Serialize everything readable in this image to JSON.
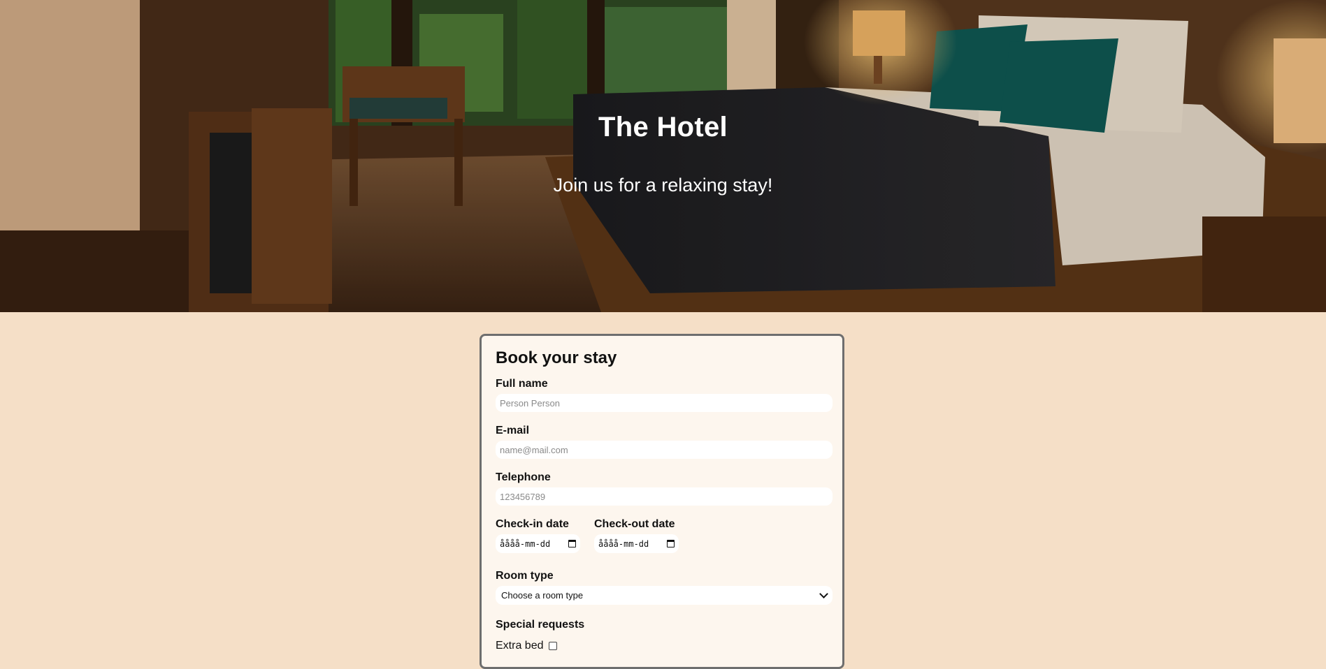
{
  "hero": {
    "title": "The Hotel",
    "subtitle": "Join us for a relaxing stay!"
  },
  "form": {
    "title": "Book your stay",
    "full_name": {
      "label": "Full name",
      "placeholder": "Person Person"
    },
    "email": {
      "label": "E-mail",
      "placeholder": "name@mail.com"
    },
    "telephone": {
      "label": "Telephone",
      "placeholder": "123456789"
    },
    "check_in": {
      "label": "Check-in date",
      "value": "åååå-mm-dd"
    },
    "check_out": {
      "label": "Check-out date",
      "value": "åååå-mm-dd"
    },
    "room_type": {
      "label": "Room type",
      "selected": "Choose a room type"
    },
    "special_requests": {
      "label": "Special requests"
    },
    "extra_bed": {
      "label": "Extra bed",
      "checked": false
    }
  },
  "colors": {
    "page_background": "#f5dfc7",
    "card_background": "#fdf6ee",
    "card_border": "#6e6e6e",
    "hero_text": "#ffffff"
  }
}
